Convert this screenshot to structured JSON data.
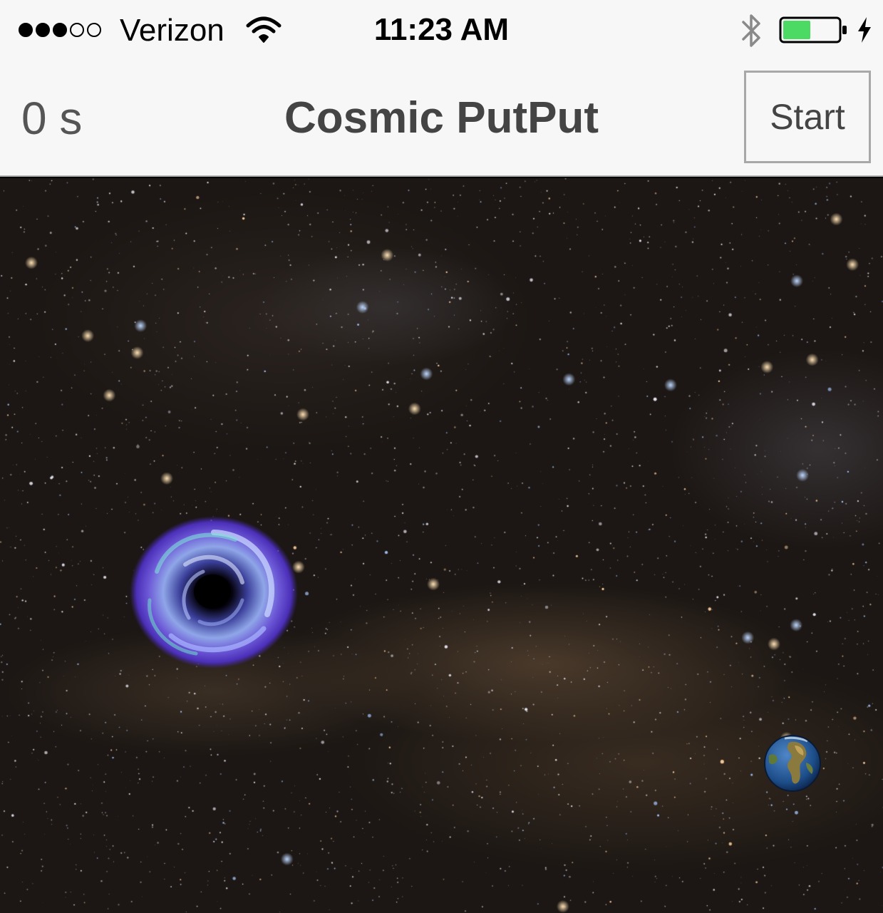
{
  "status_bar": {
    "signal_strength": 3,
    "signal_max": 5,
    "carrier": "Verizon",
    "time": "11:23 AM",
    "battery_level": 0.5,
    "charging": true,
    "icons": [
      "wifi-icon",
      "bluetooth-icon",
      "battery-icon",
      "charging-icon"
    ]
  },
  "nav_bar": {
    "timer": "0 s",
    "title": "Cosmic PutPut",
    "start_label": "Start"
  },
  "game": {
    "background": "starfield",
    "objects": [
      "black-hole-icon",
      "earth-icon"
    ]
  },
  "colors": {
    "bar_background": "#f7f7f7",
    "battery_fill": "#4cd964",
    "title_text": "#444444"
  }
}
